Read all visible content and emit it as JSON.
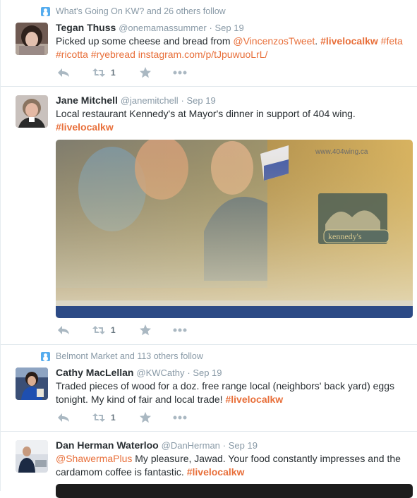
{
  "colors": {
    "accent": "#e86f3a",
    "meta": "#8899a6",
    "text": "#292f33",
    "icon": "#aab8c2",
    "context_icon": "#55acee"
  },
  "tweets": [
    {
      "context": "What's Going On KW? and 26 others follow",
      "name": "Tegan Thuss",
      "handle": "@onemamassummer",
      "time": "· Sep 19",
      "text_parts": {
        "a": "Picked up some cheese and bread from ",
        "mention": "@VincenzosTweet",
        "sep": ". ",
        "tag1": "#livelocalkw",
        "tag2": "#feta",
        "tag3": "#ricotta",
        "tag4": "#ryebread",
        "url": "instagram.com/p/tJpuwuoLrL/"
      },
      "retweets": "1"
    },
    {
      "name": "Jane Mitchell",
      "handle": "@janemitchell",
      "time": "· Sep 19",
      "text_parts": {
        "a": "Local restaurant Kennedy's at Mayor's dinner in support of 404 wing.",
        "tag1": "#livelocalkw"
      },
      "media_text": {
        "url": "www.404wing.ca",
        "brand": "kennedy's"
      },
      "retweets": "1"
    },
    {
      "context": "Belmont Market and 113 others follow",
      "name": "Cathy MacLellan",
      "handle": "@KWCathy",
      "time": "· Sep 19",
      "text_parts": {
        "a": "Traded pieces of wood for a doz. free range local (neighbors' back yard) eggs tonight. My kind of fair and local trade! ",
        "tag1": "#livelocalkw"
      },
      "retweets": "1"
    },
    {
      "name": "Dan Herman Waterloo",
      "handle": "@DanHerman",
      "time": "· Sep 19",
      "text_parts": {
        "mention": "@ShawermaPlus",
        "a": " My pleasure, Jawad. Your food constantly impresses and the cardamom coffee is fantastic. ",
        "tag1": "#livelocalkw"
      }
    }
  ]
}
